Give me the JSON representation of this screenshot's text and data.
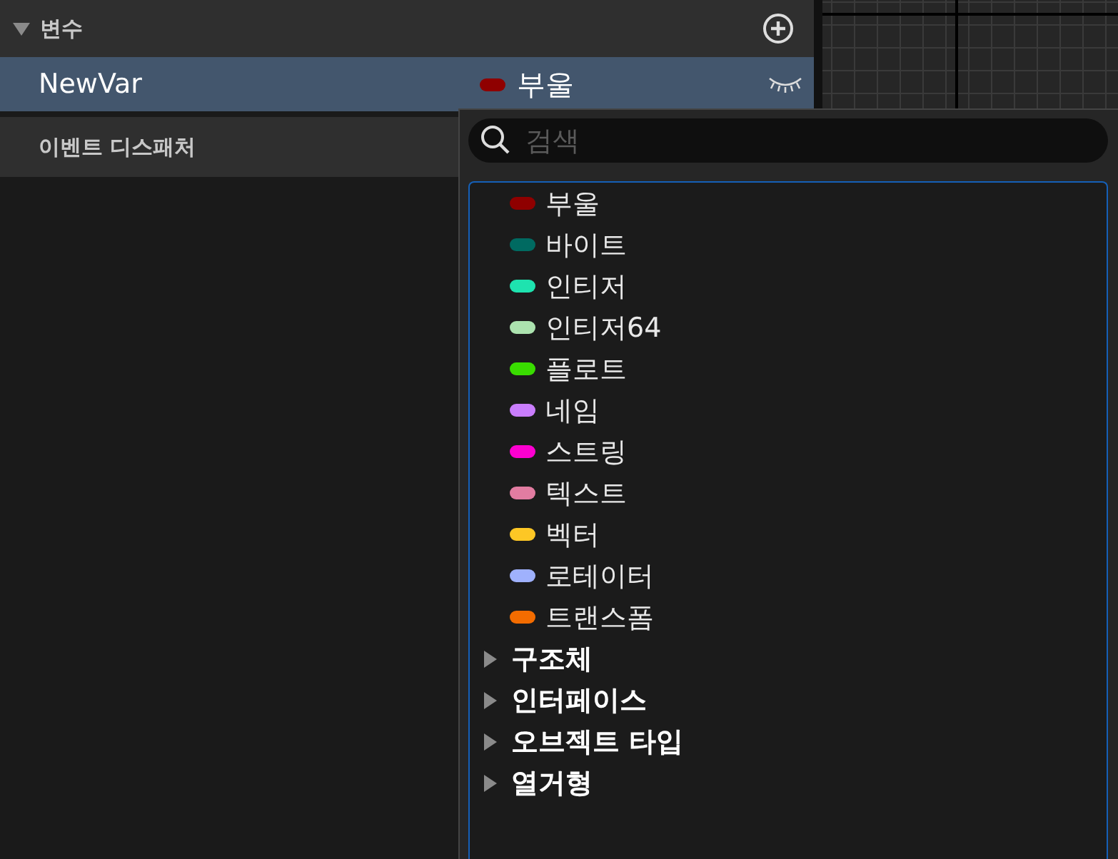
{
  "variables_panel": {
    "header": {
      "title": "변수",
      "expanded": true
    },
    "variable": {
      "name": "NewVar",
      "type_label": "부울",
      "color": "#8f0000",
      "selected": true
    },
    "event_dispatcher": {
      "title": "이벤트 디스패처"
    }
  },
  "type_picker": {
    "search": {
      "placeholder": "검색"
    },
    "items": [
      {
        "kind": "type",
        "label": "부울",
        "color": "#8f0000"
      },
      {
        "kind": "type",
        "label": "바이트",
        "color": "#006a61"
      },
      {
        "kind": "type",
        "label": "인티저",
        "color": "#1ee3af"
      },
      {
        "kind": "type",
        "label": "인티저64",
        "color": "#ace3af"
      },
      {
        "kind": "type",
        "label": "플로트",
        "color": "#39dc00"
      },
      {
        "kind": "type",
        "label": "네임",
        "color": "#c97dfc"
      },
      {
        "kind": "type",
        "label": "스트링",
        "color": "#fc00d0"
      },
      {
        "kind": "type",
        "label": "텍스트",
        "color": "#e27ca1"
      },
      {
        "kind": "type",
        "label": "벡터",
        "color": "#fdc725"
      },
      {
        "kind": "type",
        "label": "로테이터",
        "color": "#9fb1fd"
      },
      {
        "kind": "type",
        "label": "트랜스폼",
        "color": "#f36c00"
      },
      {
        "kind": "category",
        "label": "구조체",
        "expanded": false
      },
      {
        "kind": "category",
        "label": "인터페이스",
        "expanded": false
      },
      {
        "kind": "category",
        "label": "오브젝트 타입",
        "expanded": false
      },
      {
        "kind": "category",
        "label": "열거형",
        "expanded": false
      }
    ]
  }
}
